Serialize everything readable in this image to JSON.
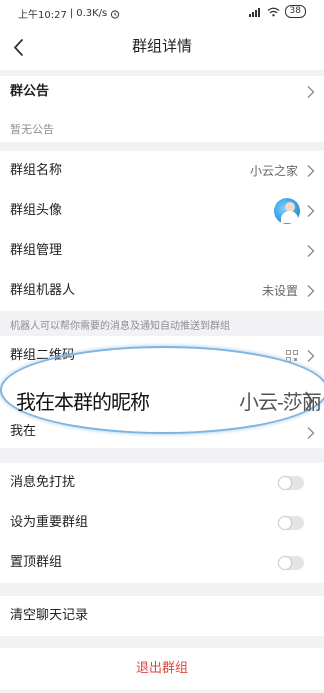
{
  "status_bar": {
    "time": "上午10:27",
    "speed": "0.3K/s",
    "battery": "38"
  },
  "nav": {
    "title": "群组详情"
  },
  "announcement": {
    "label": "群公告",
    "empty_text": "暂无公告"
  },
  "group_name": {
    "label": "群组名称",
    "value": "小云之家"
  },
  "group_avatar": {
    "label": "群组头像"
  },
  "group_manage": {
    "label": "群组管理"
  },
  "group_robot": {
    "label": "群组机器人",
    "value": "未设置"
  },
  "robot_note": "机器人可以帮你需要的消息及通知自动推送到群组",
  "qr_code": {
    "label": "群组二维码"
  },
  "nickname_row": {
    "label_partial": "我在"
  },
  "annotation": {
    "label": "我在本群的昵称",
    "value": "小云-莎丽"
  },
  "mute": {
    "label": "消息免打扰",
    "on": false
  },
  "important": {
    "label": "设为重要群组",
    "on": false
  },
  "pin": {
    "label": "置顶群组",
    "on": false
  },
  "clear_history": {
    "label": "清空聊天记录"
  },
  "exit": {
    "label": "退出群组",
    "color": "#e0453a"
  }
}
